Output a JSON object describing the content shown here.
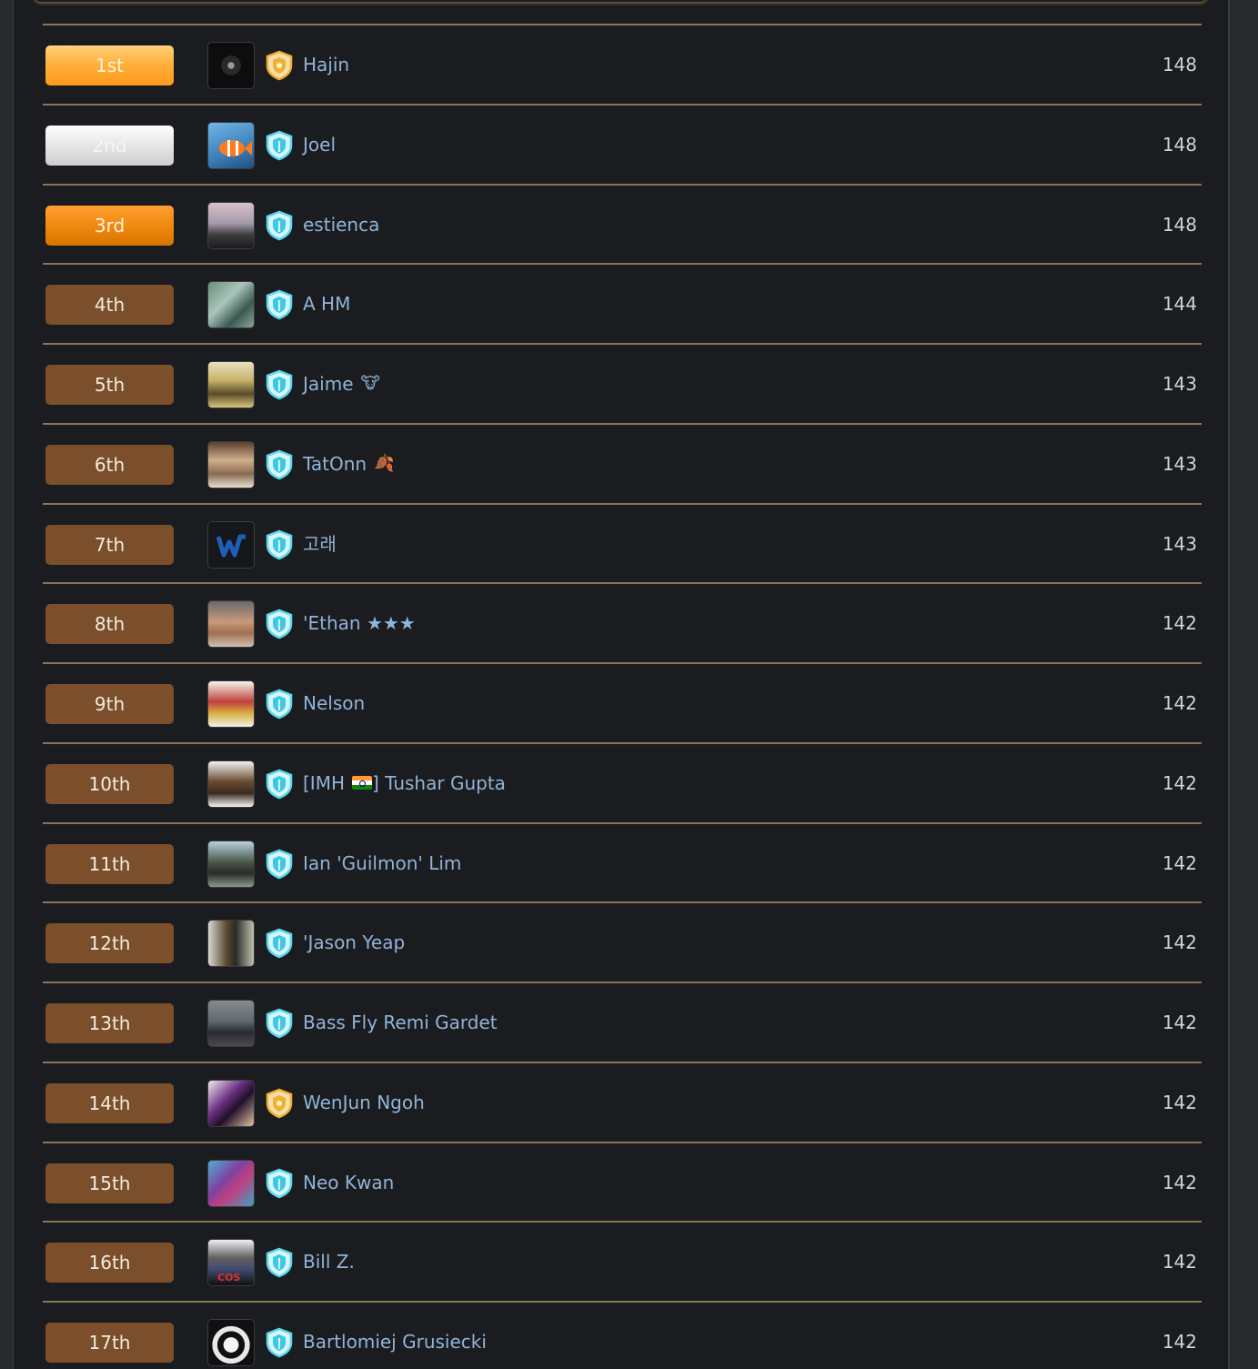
{
  "colors": {
    "background": "#1b1c1f",
    "divider": "#8b7550",
    "name": "#90b4d8",
    "score": "#cfd2d6",
    "rank_default": "#7b4f2c",
    "rank_gold": "#ffb03e",
    "rank_silver": "#e3e3e3",
    "rank_bronze": "#f08a10",
    "badge_gold": "#f0b030",
    "badge_cyan": "#5ad8f0"
  },
  "leaderboard": {
    "rows": [
      {
        "rank": "1st",
        "name": "Hajin",
        "score": "148",
        "badge_icon": "gold-shield-icon"
      },
      {
        "rank": "2nd",
        "name": "Joel",
        "score": "148",
        "badge_icon": "cyan-shield-icon"
      },
      {
        "rank": "3rd",
        "name": "estienca",
        "score": "148",
        "badge_icon": "cyan-shield-icon"
      },
      {
        "rank": "4th",
        "name": "A HM",
        "score": "144",
        "badge_icon": "cyan-shield-icon"
      },
      {
        "rank": "5th",
        "name": "Jaime",
        "score": "143",
        "badge_icon": "cyan-shield-icon",
        "emoji": "🐮"
      },
      {
        "rank": "6th",
        "name": "TatOnn",
        "score": "143",
        "badge_icon": "cyan-shield-icon",
        "emoji": "🍂"
      },
      {
        "rank": "7th",
        "name": "고래",
        "score": "143",
        "badge_icon": "cyan-shield-icon"
      },
      {
        "rank": "8th",
        "name": "'Ethan ★★★",
        "score": "142",
        "badge_icon": "cyan-shield-icon"
      },
      {
        "rank": "9th",
        "name": "Nelson",
        "score": "142",
        "badge_icon": "cyan-shield-icon"
      },
      {
        "rank": "10th",
        "name_prefix": "[IMH",
        "name_suffix": "] Tushar Gupta",
        "score": "142",
        "badge_icon": "cyan-shield-icon",
        "flag_icon": "india-flag-icon"
      },
      {
        "rank": "11th",
        "name": "Ian 'Guilmon' Lim",
        "score": "142",
        "badge_icon": "cyan-shield-icon"
      },
      {
        "rank": "12th",
        "name": "'Jason Yeap",
        "score": "142",
        "badge_icon": "cyan-shield-icon"
      },
      {
        "rank": "13th",
        "name": "Bass Fly Remi Gardet",
        "score": "142",
        "badge_icon": "cyan-shield-icon"
      },
      {
        "rank": "14th",
        "name": "WenJun Ngoh",
        "score": "142",
        "badge_icon": "gold-shield-icon"
      },
      {
        "rank": "15th",
        "name": "Neo Kwan",
        "score": "142",
        "badge_icon": "cyan-shield-icon"
      },
      {
        "rank": "16th",
        "name": "Bill Z.",
        "score": "142",
        "badge_icon": "cyan-shield-icon",
        "avatar_text": "COS"
      },
      {
        "rank": "17th",
        "name": "Bartlomiej Grusiecki",
        "score": "142",
        "badge_icon": "cyan-shield-icon"
      }
    ]
  }
}
